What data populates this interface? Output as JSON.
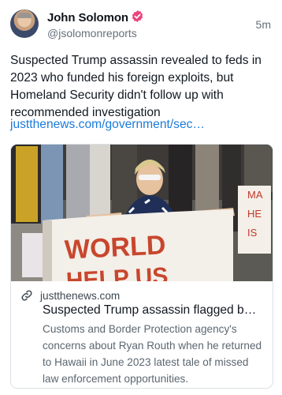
{
  "author": {
    "name": "John Solomon",
    "handle": "@jsolomonreports",
    "verified_color": "#e8467c",
    "avatar": "avatar"
  },
  "post": {
    "time": "5m",
    "text": "Suspected Trump assassin revealed to feds in 2023 who funded his foreign exploits, but Homeland Security didn't follow up with recommended investigation",
    "link": "justthenews.com/government/sec…"
  },
  "card": {
    "image": "protester-holding-world-help-us-banner",
    "domain_icon": "link-icon",
    "domain": "justthenews.com",
    "title": "Suspected Trump assassin flagged b…",
    "description": "Customs and Border Protection agency's concerns about Ryan Routh when he returned to Hawaii in June 2023 latest tale of missed law enforcement opportunities."
  },
  "colors": {
    "accent_link": "#1a7bd8",
    "text": "#111820",
    "muted": "#66707a"
  }
}
